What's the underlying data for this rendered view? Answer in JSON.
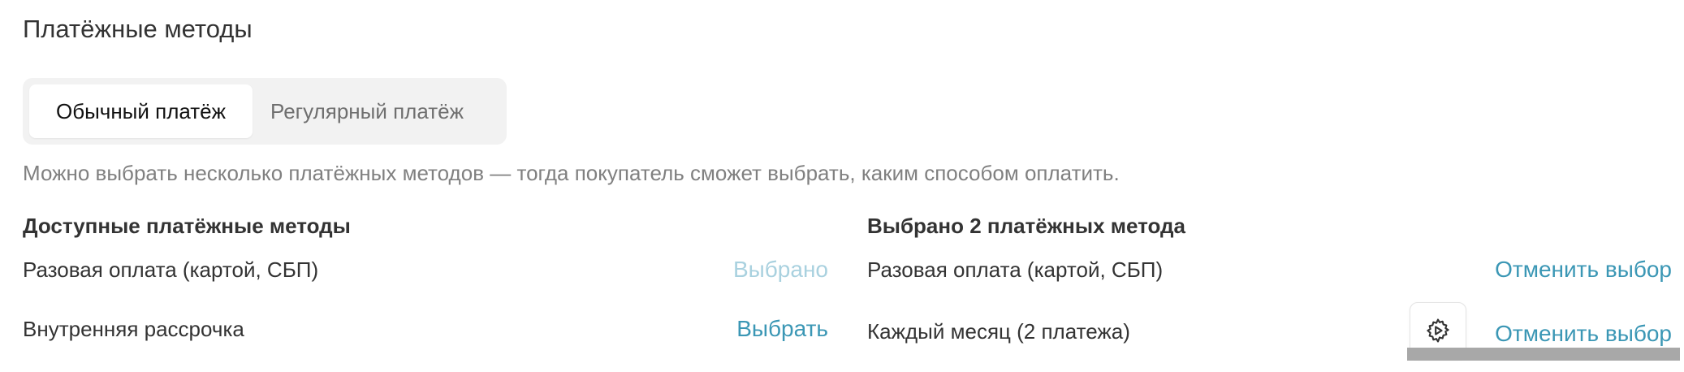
{
  "section": {
    "title": "Платёжные методы"
  },
  "tabs": [
    {
      "label": "Обычный платёж",
      "active": true
    },
    {
      "label": "Регулярный платёж",
      "active": false
    }
  ],
  "hint": "Можно выбрать несколько платёжных методов — тогда покупатель сможет выбрать, каким способом оплатить.",
  "available": {
    "heading": "Доступные платёжные методы",
    "items": [
      {
        "label": "Разовая оплата (картой, СБП)",
        "action": "Выбрано",
        "action_enabled": false
      },
      {
        "label": "Внутренняя рассрочка",
        "action": "Выбрать",
        "action_enabled": true
      }
    ]
  },
  "selected": {
    "heading": "Выбрано 2 платёжных метода",
    "items": [
      {
        "label": "Разовая оплата (картой, СБП)",
        "action": "Отменить выбор",
        "has_settings": false
      },
      {
        "label": "Каждый месяц (2 платежа)",
        "action": "Отменить выбор",
        "has_settings": true,
        "settings_icon": "gear-icon"
      }
    ]
  },
  "colors": {
    "accent": "#3b97b5",
    "accent_disabled": "#a9d1df",
    "text": "#333333",
    "muted": "#808080"
  }
}
